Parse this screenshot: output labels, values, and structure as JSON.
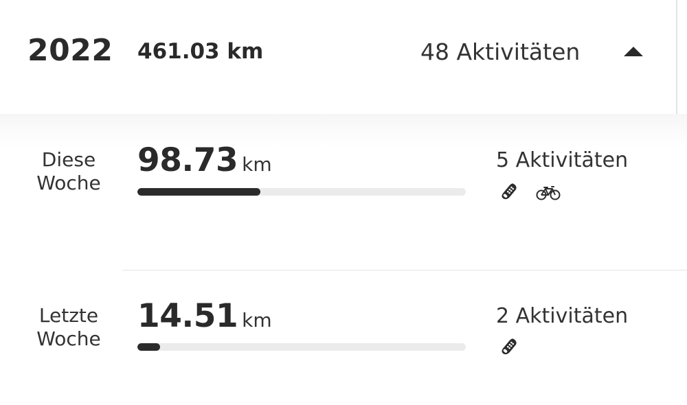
{
  "year_summary": {
    "year": "2022",
    "distance": "461.03 km",
    "activities": "48 Aktivitäten",
    "toggle_icon": "chevron-up-icon"
  },
  "weeks": [
    {
      "label_line1": "Diese",
      "label_line2": "Woche",
      "distance_value": "98.73",
      "distance_unit": "km",
      "progress_fraction": 0.375,
      "activities": "5 Aktivitäten",
      "icons": [
        "running-shoe-icon",
        "bicycle-icon"
      ]
    },
    {
      "label_line1": "Letzte",
      "label_line2": "Woche",
      "distance_value": "14.51",
      "distance_unit": "km",
      "progress_fraction": 0.07,
      "activities": "2 Aktivitäten",
      "icons": [
        "running-shoe-icon"
      ]
    }
  ],
  "colors": {
    "text": "#2b2b2b",
    "bar_fill": "#2b2b2b",
    "bar_track": "#ebebeb"
  }
}
